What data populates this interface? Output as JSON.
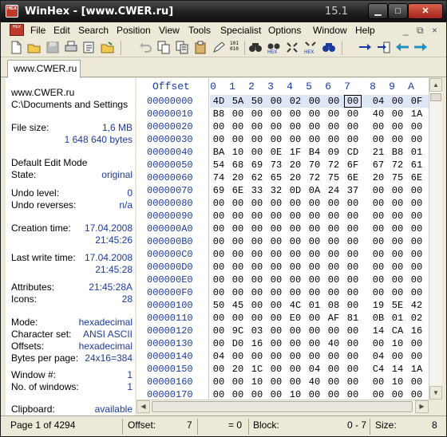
{
  "window": {
    "title": "WinHex - [www.CWER.ru]",
    "version": "15.1",
    "app_icon_text": "HEX",
    "buttons": {
      "minimize": "▁",
      "maximize": "□",
      "close": "✕"
    }
  },
  "menu": {
    "items": [
      "File",
      "Edit",
      "Search",
      "Position",
      "View",
      "Tools",
      "Specialist",
      "Options",
      "Window",
      "Help"
    ],
    "mdi_buttons": [
      "_",
      "⧉",
      "×"
    ]
  },
  "toolbar": {
    "icons": [
      "new-file-icon",
      "open-file-icon",
      "save-icon",
      "print-icon",
      "properties-icon",
      "open-folder-icon",
      "undo-icon",
      "copy-icon",
      "cut-icon",
      "paste-icon",
      "write-icon",
      "binary-icon",
      "find-text-icon",
      "find-hex-icon",
      "replace-text-icon",
      "replace-hex-icon",
      "find-again-icon",
      "goto-arrow-icon",
      "goto-offset-icon",
      "back-icon",
      "forward-icon"
    ]
  },
  "tab": {
    "label": "www.CWER.ru"
  },
  "info": {
    "file_name": "www.CWER.ru",
    "path": "C:\\Documents and Settings",
    "file_size_label": "File size:",
    "file_size_short": "1,6 MB",
    "file_size_bytes": "1 648 640 bytes",
    "edit_mode_label": "Default Edit Mode",
    "state_label": "State:",
    "state_value": "original",
    "undo_level_label": "Undo level:",
    "undo_level_value": "0",
    "undo_reverses_label": "Undo reverses:",
    "undo_reverses_value": "n/a",
    "creation_time_label": "Creation time:",
    "creation_date": "17.04.2008",
    "creation_time": "21:45:26",
    "last_write_label": "Last write time:",
    "last_write_date": "17.04.2008",
    "last_write_time": "21:45:28",
    "attributes_label": "Attributes:",
    "attributes_value": "21:45:28A",
    "icons_label": "Icons:",
    "icons_value": "28",
    "mode_label": "Mode:",
    "mode_value": "hexadecimal",
    "charset_label": "Character set:",
    "charset_value": "ANSI ASCII",
    "offsets_label": "Offsets:",
    "offsets_value": "hexadecimal",
    "bpp_label": "Bytes per page:",
    "bpp_value": "24x16=384",
    "window_num_label": "Window #:",
    "window_num_value": "1",
    "num_windows_label": "No. of windows:",
    "num_windows_value": "1",
    "clipboard_label": "Clipboard:",
    "clipboard_value": "available"
  },
  "hex": {
    "header_offset": "Offset",
    "columns": [
      "0",
      "1",
      "2",
      "3",
      "4",
      "5",
      "6",
      "7",
      "8",
      "9",
      "A"
    ],
    "offsets": [
      "00000000",
      "00000010",
      "00000020",
      "00000030",
      "00000040",
      "00000050",
      "00000060",
      "00000070",
      "00000080",
      "00000090",
      "000000A0",
      "000000B0",
      "000000C0",
      "000000D0",
      "000000E0",
      "000000F0",
      "00000100",
      "00000110",
      "00000120",
      "00000130",
      "00000140",
      "00000150",
      "00000160",
      "00000170"
    ],
    "rows": [
      [
        "4D",
        "5A",
        "50",
        "00",
        "02",
        "00",
        "00",
        "00",
        "04",
        "00",
        "0F"
      ],
      [
        "B8",
        "00",
        "00",
        "00",
        "00",
        "00",
        "00",
        "00",
        "40",
        "00",
        "1A"
      ],
      [
        "00",
        "00",
        "00",
        "00",
        "00",
        "00",
        "00",
        "00",
        "00",
        "00",
        "00"
      ],
      [
        "00",
        "00",
        "00",
        "00",
        "00",
        "00",
        "00",
        "00",
        "00",
        "00",
        "00"
      ],
      [
        "BA",
        "10",
        "00",
        "0E",
        "1F",
        "B4",
        "09",
        "CD",
        "21",
        "B8",
        "01"
      ],
      [
        "54",
        "68",
        "69",
        "73",
        "20",
        "70",
        "72",
        "6F",
        "67",
        "72",
        "61"
      ],
      [
        "74",
        "20",
        "62",
        "65",
        "20",
        "72",
        "75",
        "6E",
        "20",
        "75",
        "6E"
      ],
      [
        "69",
        "6E",
        "33",
        "32",
        "0D",
        "0A",
        "24",
        "37",
        "00",
        "00",
        "00"
      ],
      [
        "00",
        "00",
        "00",
        "00",
        "00",
        "00",
        "00",
        "00",
        "00",
        "00",
        "00"
      ],
      [
        "00",
        "00",
        "00",
        "00",
        "00",
        "00",
        "00",
        "00",
        "00",
        "00",
        "00"
      ],
      [
        "00",
        "00",
        "00",
        "00",
        "00",
        "00",
        "00",
        "00",
        "00",
        "00",
        "00"
      ],
      [
        "00",
        "00",
        "00",
        "00",
        "00",
        "00",
        "00",
        "00",
        "00",
        "00",
        "00"
      ],
      [
        "00",
        "00",
        "00",
        "00",
        "00",
        "00",
        "00",
        "00",
        "00",
        "00",
        "00"
      ],
      [
        "00",
        "00",
        "00",
        "00",
        "00",
        "00",
        "00",
        "00",
        "00",
        "00",
        "00"
      ],
      [
        "00",
        "00",
        "00",
        "00",
        "00",
        "00",
        "00",
        "00",
        "00",
        "00",
        "00"
      ],
      [
        "00",
        "00",
        "00",
        "00",
        "00",
        "00",
        "00",
        "00",
        "00",
        "00",
        "00"
      ],
      [
        "50",
        "45",
        "00",
        "00",
        "4C",
        "01",
        "08",
        "00",
        "19",
        "5E",
        "42"
      ],
      [
        "00",
        "00",
        "00",
        "00",
        "E0",
        "00",
        "AF",
        "81",
        "0B",
        "01",
        "02"
      ],
      [
        "00",
        "9C",
        "03",
        "00",
        "00",
        "00",
        "00",
        "00",
        "14",
        "CA",
        "16"
      ],
      [
        "00",
        "D0",
        "16",
        "00",
        "00",
        "00",
        "40",
        "00",
        "00",
        "10",
        "00"
      ],
      [
        "04",
        "00",
        "00",
        "00",
        "00",
        "00",
        "00",
        "00",
        "04",
        "00",
        "00"
      ],
      [
        "00",
        "20",
        "1C",
        "00",
        "00",
        "04",
        "00",
        "00",
        "C4",
        "14",
        "1A"
      ],
      [
        "00",
        "00",
        "10",
        "00",
        "00",
        "40",
        "00",
        "00",
        "00",
        "10",
        "00"
      ],
      [
        "00",
        "00",
        "00",
        "00",
        "10",
        "00",
        "00",
        "00",
        "00",
        "00",
        "00"
      ]
    ]
  },
  "status": {
    "page": "Page 1 of 4294",
    "offset_label": "Offset:",
    "offset_value": "7",
    "eq_value": "= 0",
    "block_label": "Block:",
    "block_value": "0 - 7",
    "size_label": "Size:",
    "size_value": "8"
  },
  "colors": {
    "accent_blue": "#1b3aa0",
    "title_dark": "#1d1d1d",
    "close_red": "#c0392b"
  }
}
